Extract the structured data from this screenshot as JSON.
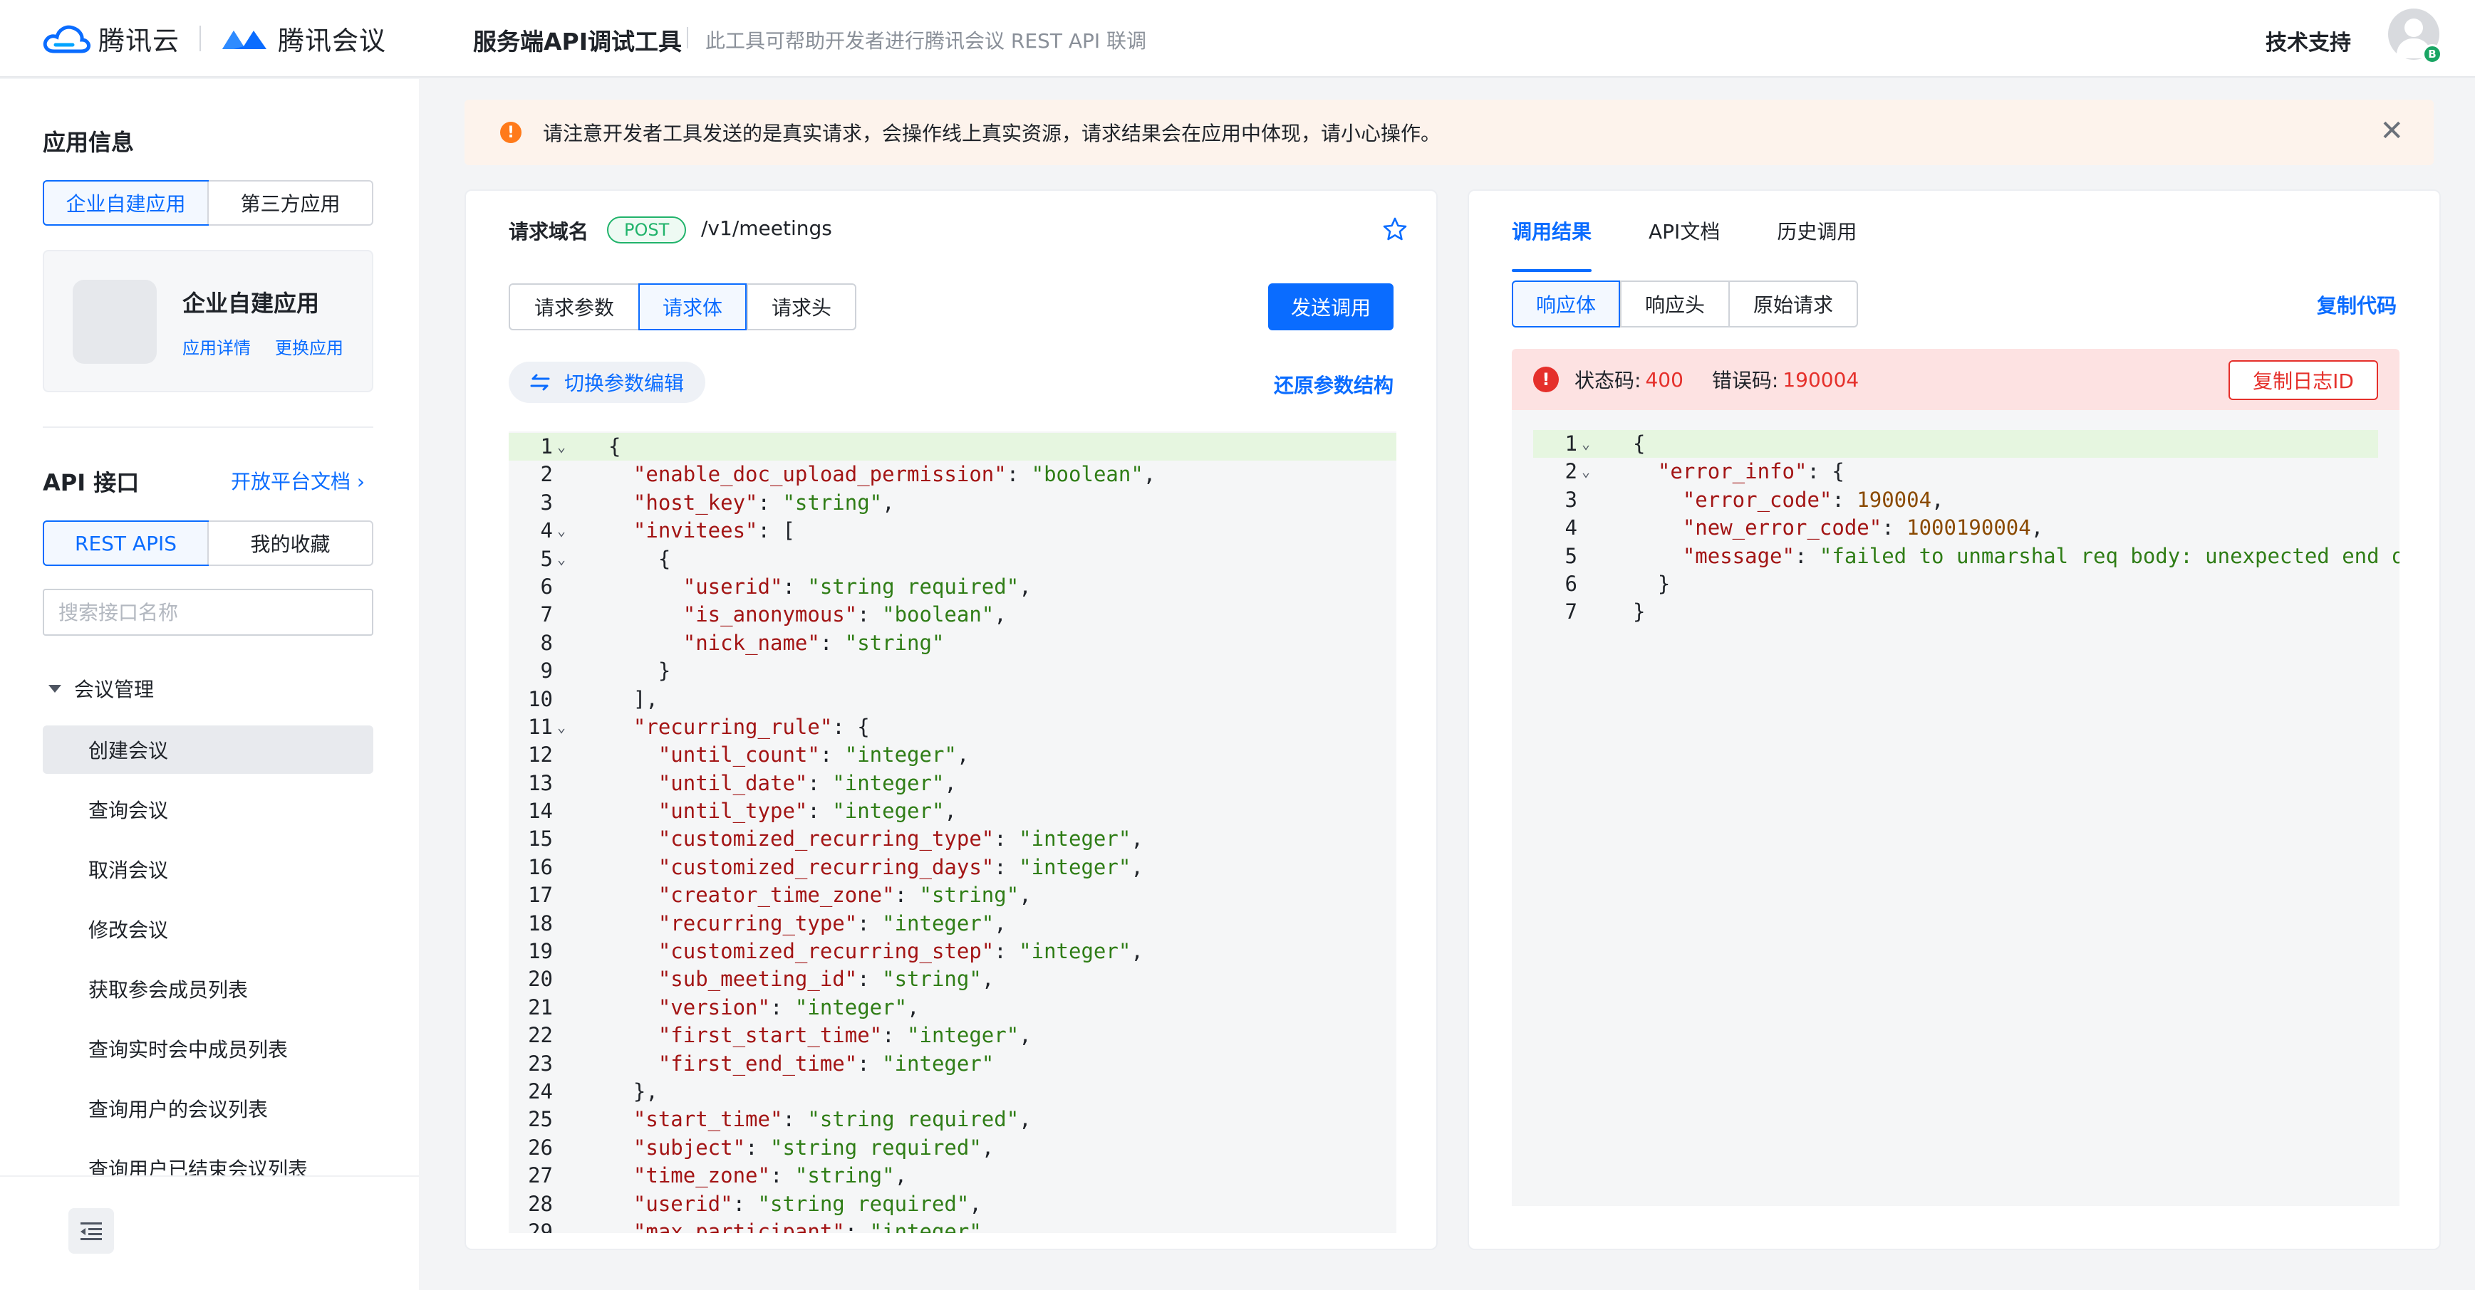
{
  "header": {
    "brand_cloud": "腾讯云",
    "brand_meeting": "腾讯会议",
    "title": "服务端API调试工具",
    "description": "此工具可帮助开发者进行腾讯会议 REST API 联调",
    "support": "技术支持",
    "avatar_badge": "B"
  },
  "sidebar": {
    "app_info_title": "应用信息",
    "app_types": [
      "企业自建应用",
      "第三方应用"
    ],
    "app_card": {
      "name": "企业自建应用",
      "detail_link": "应用详情",
      "switch_link": "更换应用"
    },
    "api_title": "API 接口",
    "open_docs": "开放平台文档 ›",
    "api_tabs": [
      "REST APIS",
      "我的收藏"
    ],
    "search_placeholder": "搜索接口名称",
    "group": "会议管理",
    "items": [
      "创建会议",
      "查询会议",
      "取消会议",
      "修改会议",
      "获取参会成员列表",
      "查询实时会中成员列表",
      "查询用户的会议列表",
      "查询用户已结束会议列表"
    ],
    "active_item": "创建会议"
  },
  "notice": {
    "text": "请注意开发者工具发送的是真实请求，会操作线上真实资源，请求结果会在应用中体现，请小心操作。",
    "close": "✕"
  },
  "request": {
    "domain_label": "请求域名",
    "method": "POST",
    "path": "/v1/meetings",
    "tabs": [
      "请求参数",
      "请求体",
      "请求头"
    ],
    "active_tab": "请求体",
    "send_label": "发送调用",
    "switch_label": "切换参数编辑",
    "restore_label": "还原参数结构",
    "code": [
      {
        "n": "1",
        "fold": true,
        "text": "{"
      },
      {
        "n": "2",
        "fold": false,
        "text": "  \"enable_doc_upload_permission\": \"boolean\","
      },
      {
        "n": "3",
        "fold": false,
        "text": "  \"host_key\": \"string\","
      },
      {
        "n": "4",
        "fold": true,
        "text": "  \"invitees\": ["
      },
      {
        "n": "5",
        "fold": true,
        "text": "    {"
      },
      {
        "n": "6",
        "fold": false,
        "text": "      \"userid\": \"string required\","
      },
      {
        "n": "7",
        "fold": false,
        "text": "      \"is_anonymous\": \"boolean\","
      },
      {
        "n": "8",
        "fold": false,
        "text": "      \"nick_name\": \"string\""
      },
      {
        "n": "9",
        "fold": false,
        "text": "    }"
      },
      {
        "n": "10",
        "fold": false,
        "text": "  ],"
      },
      {
        "n": "11",
        "fold": true,
        "text": "  \"recurring_rule\": {"
      },
      {
        "n": "12",
        "fold": false,
        "text": "    \"until_count\": \"integer\","
      },
      {
        "n": "13",
        "fold": false,
        "text": "    \"until_date\": \"integer\","
      },
      {
        "n": "14",
        "fold": false,
        "text": "    \"until_type\": \"integer\","
      },
      {
        "n": "15",
        "fold": false,
        "text": "    \"customized_recurring_type\": \"integer\","
      },
      {
        "n": "16",
        "fold": false,
        "text": "    \"customized_recurring_days\": \"integer\","
      },
      {
        "n": "17",
        "fold": false,
        "text": "    \"creator_time_zone\": \"string\","
      },
      {
        "n": "18",
        "fold": false,
        "text": "    \"recurring_type\": \"integer\","
      },
      {
        "n": "19",
        "fold": false,
        "text": "    \"customized_recurring_step\": \"integer\","
      },
      {
        "n": "20",
        "fold": false,
        "text": "    \"sub_meeting_id\": \"string\","
      },
      {
        "n": "21",
        "fold": false,
        "text": "    \"version\": \"integer\","
      },
      {
        "n": "22",
        "fold": false,
        "text": "    \"first_start_time\": \"integer\","
      },
      {
        "n": "23",
        "fold": false,
        "text": "    \"first_end_time\": \"integer\""
      },
      {
        "n": "24",
        "fold": false,
        "text": "  },"
      },
      {
        "n": "25",
        "fold": false,
        "text": "  \"start_time\": \"string required\","
      },
      {
        "n": "26",
        "fold": false,
        "text": "  \"subject\": \"string required\","
      },
      {
        "n": "27",
        "fold": false,
        "text": "  \"time_zone\": \"string\","
      },
      {
        "n": "28",
        "fold": false,
        "text": "  \"userid\": \"string required\","
      },
      {
        "n": "29",
        "fold": false,
        "text": "  \"max_participant\": \"integer\","
      }
    ]
  },
  "result": {
    "tabs": [
      "调用结果",
      "API文档",
      "历史调用"
    ],
    "active_tab": "调用结果",
    "sub_tabs": [
      "响应体",
      "响应头",
      "原始请求"
    ],
    "active_sub_tab": "响应体",
    "copy_code": "复制代码",
    "status_label": "状态码:",
    "status_value": "400",
    "error_label": "错误码:",
    "error_value": "190004",
    "copy_log": "复制日志ID",
    "code": [
      {
        "n": "1",
        "fold": true,
        "text": "{"
      },
      {
        "n": "2",
        "fold": true,
        "text": "  \"error_info\": {"
      },
      {
        "n": "3",
        "fold": false,
        "text": "    \"error_code\": 190004,"
      },
      {
        "n": "4",
        "fold": false,
        "text": "    \"new_error_code\": 1000190004,"
      },
      {
        "n": "5",
        "fold": false,
        "text": "    \"message\": \"failed to unmarshal req body: unexpected end of"
      },
      {
        "n": "6",
        "fold": false,
        "text": "  }"
      },
      {
        "n": "7",
        "fold": false,
        "text": "}"
      }
    ]
  },
  "colors": {
    "accent": "#0a6cff",
    "success": "#21b36b",
    "error": "#e5302b",
    "warning": "#ff7a1a"
  }
}
